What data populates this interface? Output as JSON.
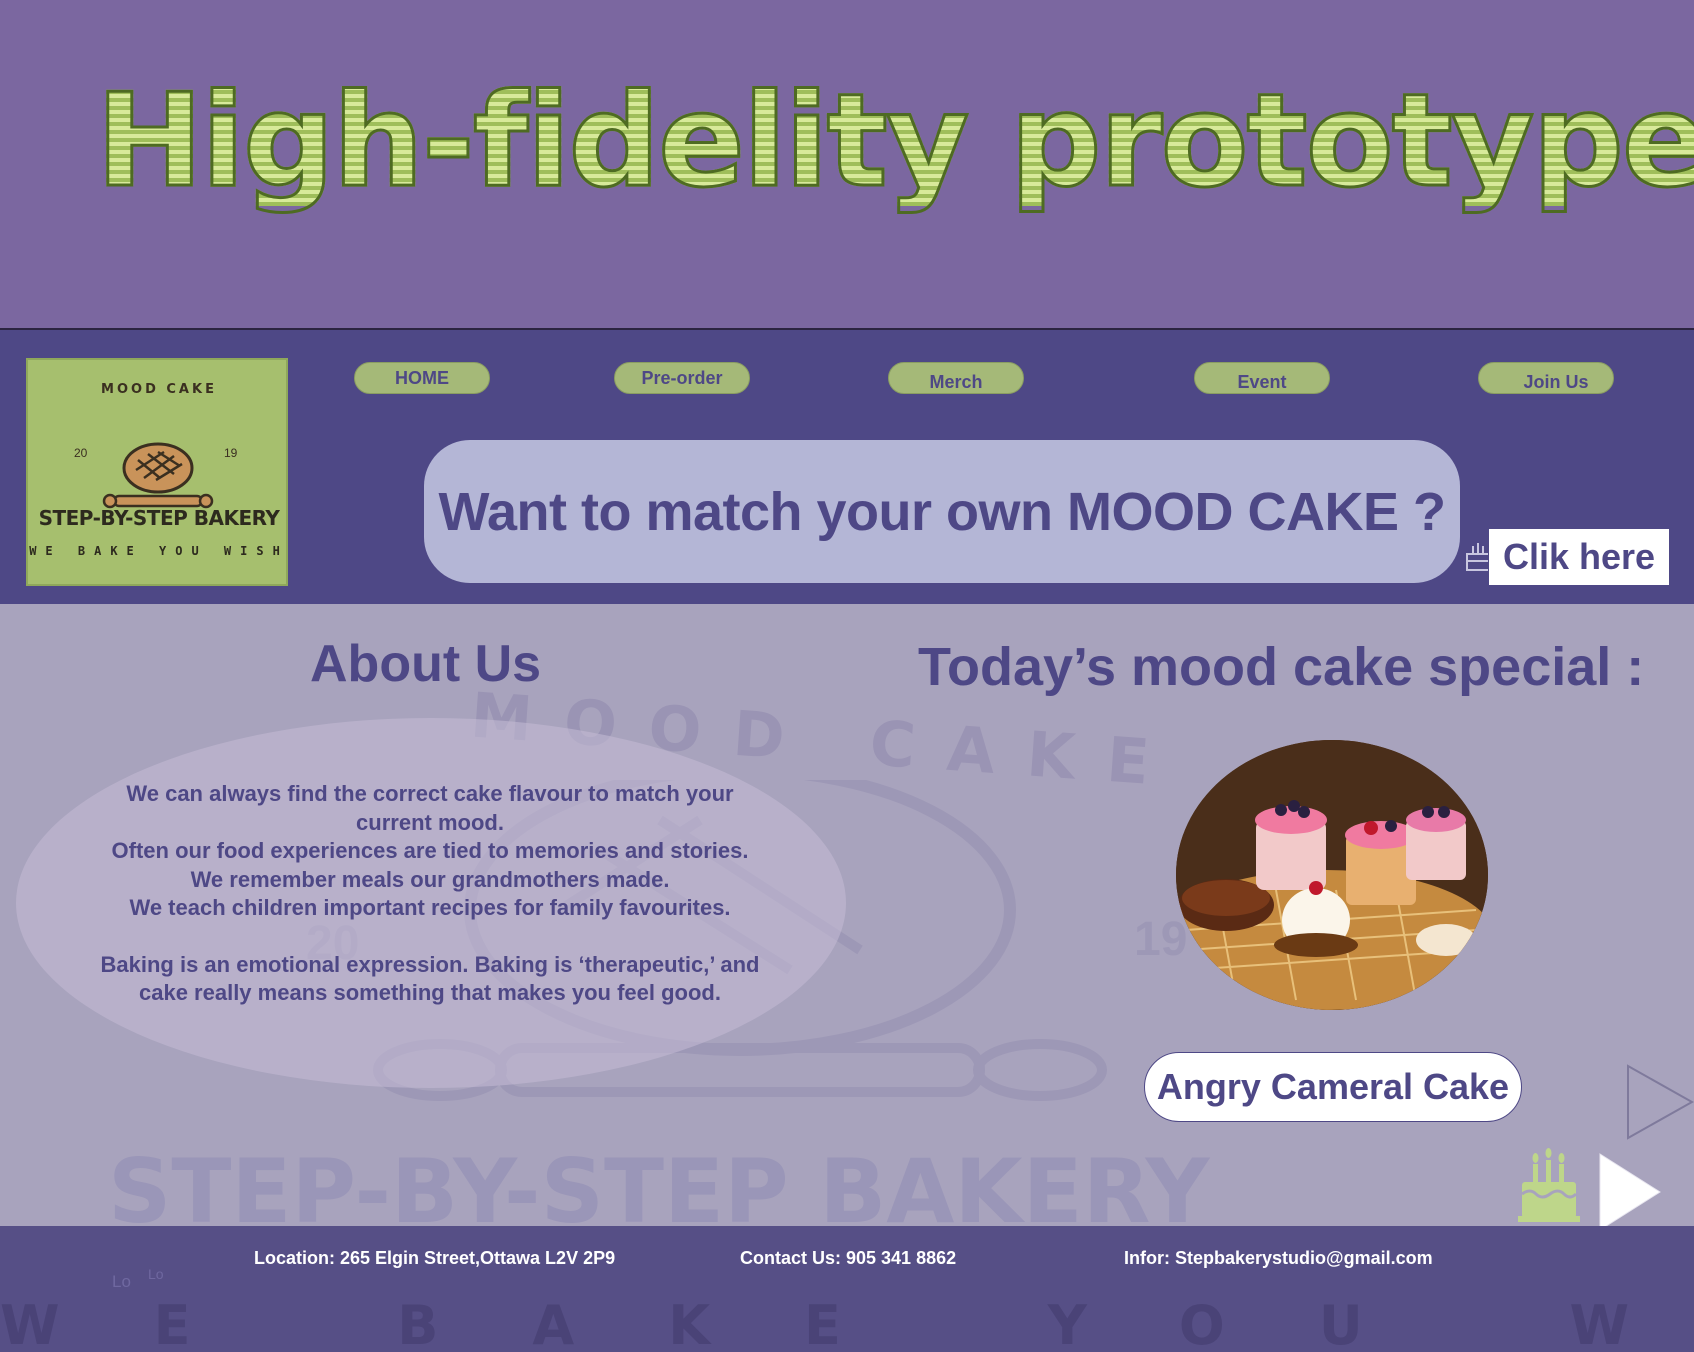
{
  "banner": {
    "title": "High-fidelity prototype"
  },
  "logo": {
    "arc_text": "MOOD CAKE",
    "year_left": "20",
    "year_right": "19",
    "name": "STEP-BY-STEP BAKERY",
    "tagline": "WE BAKE YOU WISH"
  },
  "nav": {
    "home": "HOME",
    "preorder": "Pre-order",
    "merch": "Merch",
    "event": "Event",
    "join": "Join Us"
  },
  "cta": {
    "text": "Want to match your own MOOD CAKE ?",
    "button": "Clik here"
  },
  "about": {
    "title": "About Us",
    "lines": [
      "We can always find the correct cake flavour to match your current mood.",
      "Often our food experiences are tied to memories and stories.",
      "We remember meals our grandmothers made.",
      "We teach children important recipes for family favourites.",
      "Baking is an emotional expression. Baking is ‘therapeutic,’ and cake really means something that makes you feel good."
    ]
  },
  "special": {
    "title": "Today’s mood cake special :",
    "cake_name": "Angry Cameral Cake"
  },
  "watermark": {
    "arc": "MOOD CAKE",
    "year_left": "20",
    "year_right": "19",
    "name": "STEP-BY-STEP BAKERY",
    "tagline": "WE BAKE YOU WISH",
    "lo_1": "Lo",
    "lo_2": "Lo"
  },
  "footer": {
    "location": "Location: 265 Elgin Street,Ottawa L2V 2P9",
    "contact": "Contact Us: 905 341 8862",
    "info": "Infor: Stepbakerystudio@gmail.com"
  },
  "icons": {
    "cta_icon": "cake-icon",
    "next_outline": "play-outline-icon",
    "next_solid": "play-icon",
    "corner_cake": "birthday-cake-icon"
  },
  "colors": {
    "banner_bg": "#7b67a0",
    "header_bg": "#4e4886",
    "accent_green": "#a5b978",
    "text_purple": "#4e4886",
    "main_bg": "#a8a3bd",
    "footer_bg": "#564f86"
  }
}
